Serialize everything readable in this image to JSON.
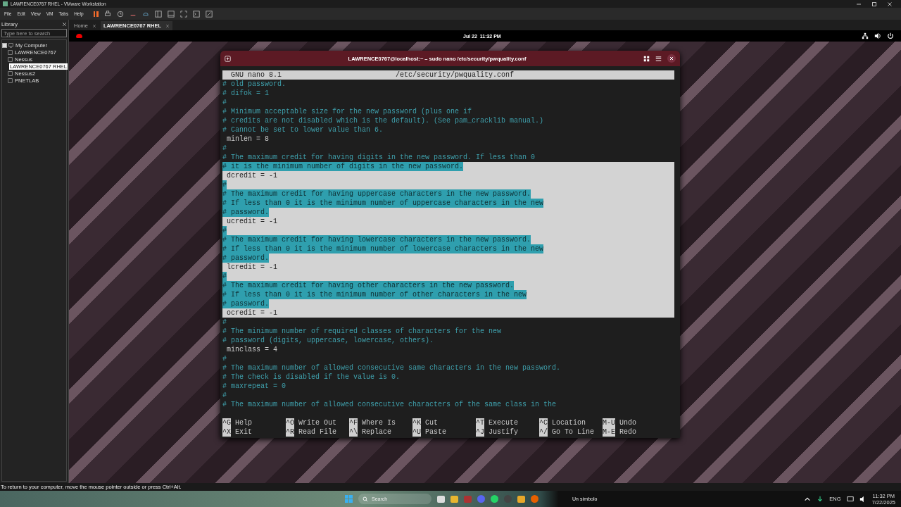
{
  "app": {
    "title": "LAWRENCE0767 RHEL - VMware Workstation"
  },
  "menu": [
    "File",
    "Edit",
    "View",
    "VM",
    "Tabs",
    "Help"
  ],
  "library": {
    "title": "Library",
    "search": {
      "placeholder": "Type here to search"
    },
    "tree": [
      {
        "label": "My Computer",
        "expanded": true,
        "selected": false,
        "children": [
          {
            "label": "LAWRENCE0767",
            "selected": false
          },
          {
            "label": "Nessus",
            "selected": false
          },
          {
            "label": "LAWRENCE0767 RHEL",
            "selected": true
          },
          {
            "label": "Nessus2",
            "selected": false
          },
          {
            "label": "PNETLAB",
            "selected": false
          }
        ]
      }
    ]
  },
  "tabs": [
    {
      "label": "Home",
      "selected": false
    },
    {
      "label": "LAWRENCE0767 RHEL",
      "selected": true
    }
  ],
  "gnome_bar": {
    "clock": "Jul 22  11:32 PM"
  },
  "terminal": {
    "title": "LAWRENCE0767@localhost:~ – sudo nano /etc/security/pwquality.conf",
    "nano": {
      "version": "GNU nano 8.1",
      "file": "/etc/security/pwquality.conf"
    },
    "lines": [
      {
        "text": "# old password.",
        "kind": "comment",
        "selected": false
      },
      {
        "text": "# difok = 1",
        "kind": "comment",
        "selected": false
      },
      {
        "text": "#",
        "kind": "comment",
        "selected": false
      },
      {
        "text": "# Minimum acceptable size for the new password (plus one if",
        "kind": "comment",
        "selected": false
      },
      {
        "text": "# credits are not disabled which is the default). (See pam_cracklib manual.)",
        "kind": "comment",
        "selected": false
      },
      {
        "text": "# Cannot be set to lower value than 6.",
        "kind": "comment",
        "selected": false
      },
      {
        "text": " minlen = 8",
        "kind": "setting",
        "selected": false
      },
      {
        "text": "#",
        "kind": "comment",
        "selected": false
      },
      {
        "text": "# The maximum credit for having digits in the new password. If less than 0",
        "kind": "comment",
        "selected": false
      },
      {
        "text": "# it is the minimum number of digits in the new password.",
        "kind": "comment",
        "selected": true
      },
      {
        "text": " dcredit = -1",
        "kind": "setting",
        "selected": true
      },
      {
        "text": "#",
        "kind": "comment",
        "selected": true
      },
      {
        "text": "# The maximum credit for having uppercase characters in the new password.",
        "kind": "comment",
        "selected": true
      },
      {
        "text": "# If less than 0 it is the minimum number of uppercase characters in the new",
        "kind": "comment",
        "selected": true
      },
      {
        "text": "# password.",
        "kind": "comment",
        "selected": true
      },
      {
        "text": " ucredit = -1",
        "kind": "setting",
        "selected": true
      },
      {
        "text": "#",
        "kind": "comment",
        "selected": true
      },
      {
        "text": "# The maximum credit for having lowercase characters in the new password.",
        "kind": "comment",
        "selected": true
      },
      {
        "text": "# If less than 0 it is the minimum number of lowercase characters in the new",
        "kind": "comment",
        "selected": true
      },
      {
        "text": "# password.",
        "kind": "comment",
        "selected": true
      },
      {
        "text": " lcredit = -1",
        "kind": "setting",
        "selected": true
      },
      {
        "text": "#",
        "kind": "comment",
        "selected": true
      },
      {
        "text": "# The maximum credit for having other characters in the new password.",
        "kind": "comment",
        "selected": true
      },
      {
        "text": "# If less than 0 it is the minimum number of other characters in the new",
        "kind": "comment",
        "selected": true
      },
      {
        "text": "# password.",
        "kind": "comment",
        "selected": true
      },
      {
        "text": " ocredit = -1",
        "kind": "setting",
        "selected": true
      },
      {
        "text": "#",
        "kind": "comment",
        "selected": false
      },
      {
        "text": "# The minimum number of required classes of characters for the new",
        "kind": "comment",
        "selected": false
      },
      {
        "text": "# password (digits, uppercase, lowercase, others).",
        "kind": "comment",
        "selected": false
      },
      {
        "text": " minclass = 4",
        "kind": "setting",
        "selected": false
      },
      {
        "text": "#",
        "kind": "comment",
        "selected": false
      },
      {
        "text": "# The maximum number of allowed consecutive same characters in the new password.",
        "kind": "comment",
        "selected": false
      },
      {
        "text": "# The check is disabled if the value is 0.",
        "kind": "comment",
        "selected": false
      },
      {
        "text": "# maxrepeat = 0",
        "kind": "comment",
        "selected": false
      },
      {
        "text": "#",
        "kind": "comment",
        "selected": false
      },
      {
        "text": "# The maximum number of allowed consecutive characters of the same class in the",
        "kind": "comment",
        "selected": false
      }
    ],
    "shortcuts": [
      {
        "key": "^G",
        "label": "Help"
      },
      {
        "key": "^O",
        "label": "Write Out"
      },
      {
        "key": "^F",
        "label": "Where Is"
      },
      {
        "key": "^K",
        "label": "Cut"
      },
      {
        "key": "^T",
        "label": "Execute"
      },
      {
        "key": "^C",
        "label": "Location"
      },
      {
        "key": "M-U",
        "label": "Undo"
      },
      {
        "key": "^X",
        "label": "Exit"
      },
      {
        "key": "^R",
        "label": "Read File"
      },
      {
        "key": "^\\",
        "label": "Replace"
      },
      {
        "key": "^U",
        "label": "Paste"
      },
      {
        "key": "^J",
        "label": "Justify"
      },
      {
        "key": "^/",
        "label": "Go To Line"
      },
      {
        "key": "M-E",
        "label": "Redo"
      }
    ]
  },
  "status_bar": "To return to your computer, move the mouse pointer outside or press Ctrl+Alt.",
  "taskbar": {
    "search": "Search",
    "media": "Un símbolo",
    "language": "ENG",
    "time": "11:32 PM",
    "date": "7/22/2025"
  }
}
